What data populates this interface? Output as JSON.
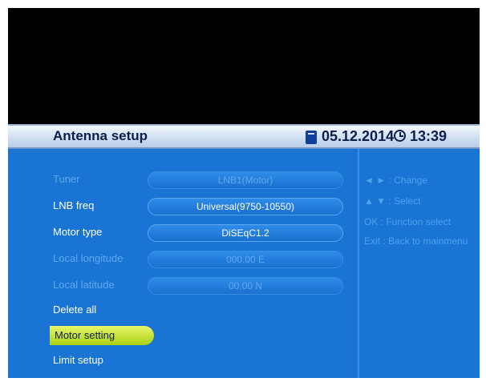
{
  "header": {
    "title": "Antenna setup",
    "date": "05.12.2014",
    "time": "13:39"
  },
  "settings": [
    {
      "label": "Tuner",
      "value": "LNB1(Motor)",
      "enabled": false
    },
    {
      "label": "LNB freq",
      "value": "Universal(9750-10550)",
      "enabled": true
    },
    {
      "label": "Motor type",
      "value": "DiSEqC1.2",
      "enabled": true
    },
    {
      "label": "Local longitude",
      "value": "000.00 E",
      "enabled": false
    },
    {
      "label": "Local latitude",
      "value": "00.00 N",
      "enabled": false
    }
  ],
  "actions": [
    {
      "label": "Delete all",
      "selected": false
    },
    {
      "label": "Motor setting",
      "selected": true
    },
    {
      "label": "Limit setup",
      "selected": false
    }
  ],
  "help": [
    {
      "keys": "◄ ► :",
      "text": "Change"
    },
    {
      "keys": "▲ ▼ :",
      "text": "Select"
    },
    {
      "keys": "OK",
      "text": ": Function select"
    },
    {
      "keys": "Exit",
      "text": ": Back to mainmenu"
    }
  ],
  "colors": {
    "panel": "#1a74d4",
    "header": "#cfdff2",
    "highlight": "#c6e22b",
    "disabled_text": "#5ea9ee"
  }
}
